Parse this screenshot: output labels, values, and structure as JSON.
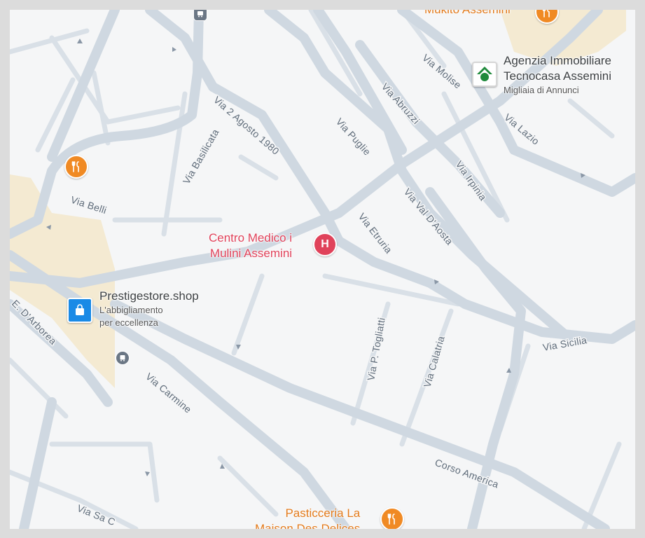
{
  "colors": {
    "food_pin": "#f08a24",
    "hospital_pin": "#e0425a",
    "shop_pin": "#1a8ae6",
    "realestate_pin": "#1f8a3b",
    "food_text": "#e27a1b",
    "hospital_text": "#e0425a",
    "poi_text": "#3c4043",
    "sand": "#f4ead2"
  },
  "streets": {
    "via_2_agosto": "Via 2 Agosto 1980",
    "via_basilicata": "Via Basilicata",
    "via_puglie": "Via Puglie",
    "via_abruzzi": "Via Abruzzi",
    "via_molise": "Via Molise",
    "via_lazio": "Via Lazio",
    "via_irpinia": "Via Irpinia",
    "via_belli": "Via Belli",
    "via_etruria": "Via Etruria",
    "via_val_daosta": "Via Val D'Aosta",
    "e_darborea": "E. D'Arborea",
    "via_togliatti": "Via P. Togliatti",
    "via_calatria": "Via Calatria",
    "via_sicilia": "Via Sicilia",
    "via_carmine": "Via Carmine",
    "corso_america": "Corso America",
    "via_sa": "Via Sa C"
  },
  "pois": {
    "mukito": {
      "name": "Mukito Assemini",
      "icon": "restaurant-icon"
    },
    "tecnocasa": {
      "name_line1": "Agenzia Immobiliare",
      "name_line2": "Tecnocasa Assemini",
      "subtitle": "Migliaia di Annunci",
      "icon": "house-icon"
    },
    "restaurant_west": {
      "icon": "restaurant-icon"
    },
    "centro_medico": {
      "name_line1": "Centro Medico i",
      "name_line2": "Mulini Assemini",
      "icon": "hospital-icon",
      "letter": "H"
    },
    "prestige": {
      "name": "Prestigestore.shop",
      "subtitle_line1": "L'abbigliamento",
      "subtitle_line2": "per eccellenza",
      "icon": "shopping-bag-icon"
    },
    "pasticceria": {
      "name_line1": "Pasticceria La",
      "name_line2": "Maison Des Delices",
      "icon": "restaurant-icon"
    },
    "bus_stop": {
      "icon": "bus-stop-icon"
    },
    "top_transit": {
      "icon": "transit-icon"
    }
  }
}
